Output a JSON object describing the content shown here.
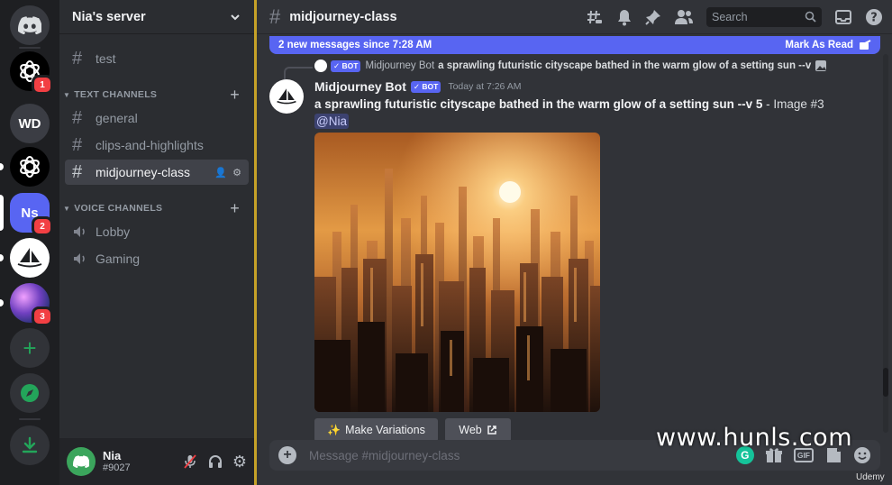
{
  "servers": [
    {
      "name": "Discord home",
      "icon": "discord-logo-icon"
    },
    {
      "name": "ChatGPT server",
      "icon": "openai-icon",
      "badge": "1"
    },
    {
      "name": "WD",
      "initials": "WD"
    },
    {
      "name": "OpenAI server",
      "icon": "openai-icon"
    },
    {
      "name": "Nia's server",
      "initials": "Ns",
      "badge": "2"
    },
    {
      "name": "Midjourney",
      "icon": "sailboat-icon"
    },
    {
      "name": "Galaxy server",
      "icon": "galaxy-icon",
      "badge": "3"
    },
    {
      "name": "Add a server",
      "icon": "plus-icon"
    },
    {
      "name": "Explore servers",
      "icon": "compass-icon"
    },
    {
      "name": "Download apps",
      "icon": "download-icon"
    }
  ],
  "sidebar": {
    "server_name": "Nia's server",
    "top_channel": "test",
    "text_category": "TEXT CHANNELS",
    "text_channels": [
      "general",
      "clips-and-highlights",
      "midjourney-class"
    ],
    "voice_category": "VOICE CHANNELS",
    "voice_channels": [
      "Lobby",
      "Gaming"
    ]
  },
  "user": {
    "name": "Nia",
    "tag": "#9027"
  },
  "header": {
    "channel": "midjourney-class",
    "search_placeholder": "Search"
  },
  "new_messages": {
    "text": "2 new messages since 7:28 AM",
    "action": "Mark As Read"
  },
  "reply": {
    "tag": "BOT",
    "author": "Midjourney Bot",
    "text": "a sprawling futuristic cityscape bathed in the warm glow of a setting sun --v"
  },
  "message": {
    "author": "Midjourney Bot",
    "tag": "BOT",
    "timestamp": "Today at 7:26 AM",
    "prompt": "a sprawling futuristic cityscape bathed in the warm glow of a setting sun --v 5",
    "suffix": " - Image #3",
    "mention": "@Nia",
    "buttons": [
      "Make Variations",
      "Web"
    ]
  },
  "composer": {
    "placeholder": "Message #midjourney-class",
    "gif": "GIF"
  },
  "watermark": "www.hunls.com",
  "udemy": "Udemy",
  "colors": {
    "blurple": "#5865f2",
    "accent_border": "#c6a228",
    "badge": "#f23f43",
    "online": "#3ba55c"
  }
}
